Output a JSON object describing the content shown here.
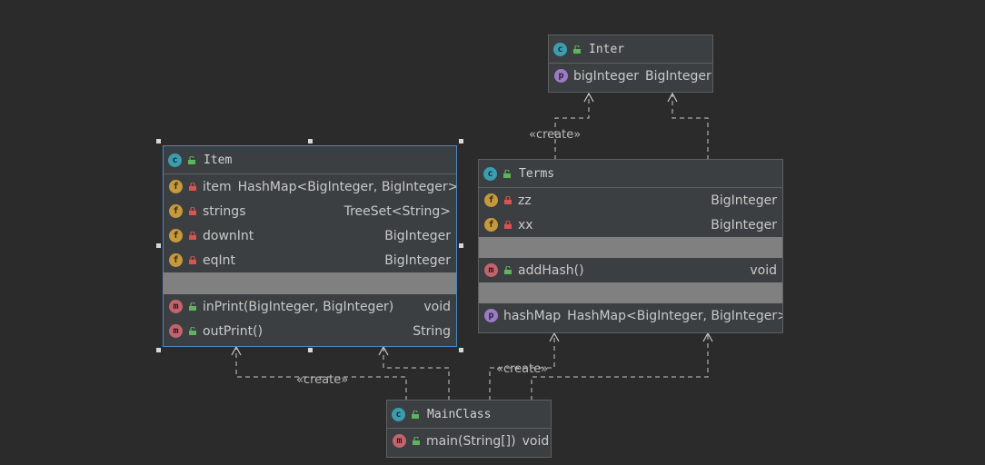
{
  "labels": {
    "create_1": "«create»",
    "create_2": "«create»",
    "create_3": "«create»"
  },
  "classes": {
    "inter": {
      "name": "Inter",
      "properties": [
        {
          "name": "bigInteger",
          "type": "BigInteger"
        }
      ]
    },
    "item": {
      "name": "Item",
      "fields": [
        {
          "name": "item",
          "type": "HashMap<BigInteger, BigInteger>",
          "right": ""
        },
        {
          "name": "strings",
          "type": "",
          "right": "TreeSet<String>"
        },
        {
          "name": "downInt",
          "type": "",
          "right": "BigInteger"
        },
        {
          "name": "eqInt",
          "type": "",
          "right": "BigInteger"
        }
      ],
      "methods": [
        {
          "name": "inPrint(BigInteger, BigInteger)",
          "ret": "void"
        },
        {
          "name": "outPrint()",
          "ret": "String"
        }
      ]
    },
    "terms": {
      "name": "Terms",
      "fields": [
        {
          "name": "zz",
          "ret": "BigInteger"
        },
        {
          "name": "xx",
          "ret": "BigInteger"
        }
      ],
      "methods": [
        {
          "name": "addHash()",
          "ret": "void"
        }
      ],
      "properties": [
        {
          "name": "hashMap",
          "type": "HashMap<BigInteger, BigInteger>"
        }
      ]
    },
    "mainclass": {
      "name": "MainClass",
      "methods": [
        {
          "name": "main(String[])",
          "ret": "void"
        }
      ]
    }
  },
  "icons": {
    "class": "class-icon",
    "field": "field-icon",
    "method": "method-icon",
    "property": "property-icon",
    "lock_private": "lock-icon",
    "lock_public": "unlock-icon"
  },
  "colors": {
    "background": "#2b2b2b",
    "node": "#3c3f41",
    "selection": "#4a88c7",
    "separator": "#808080",
    "edge": "#a9b7c6"
  }
}
